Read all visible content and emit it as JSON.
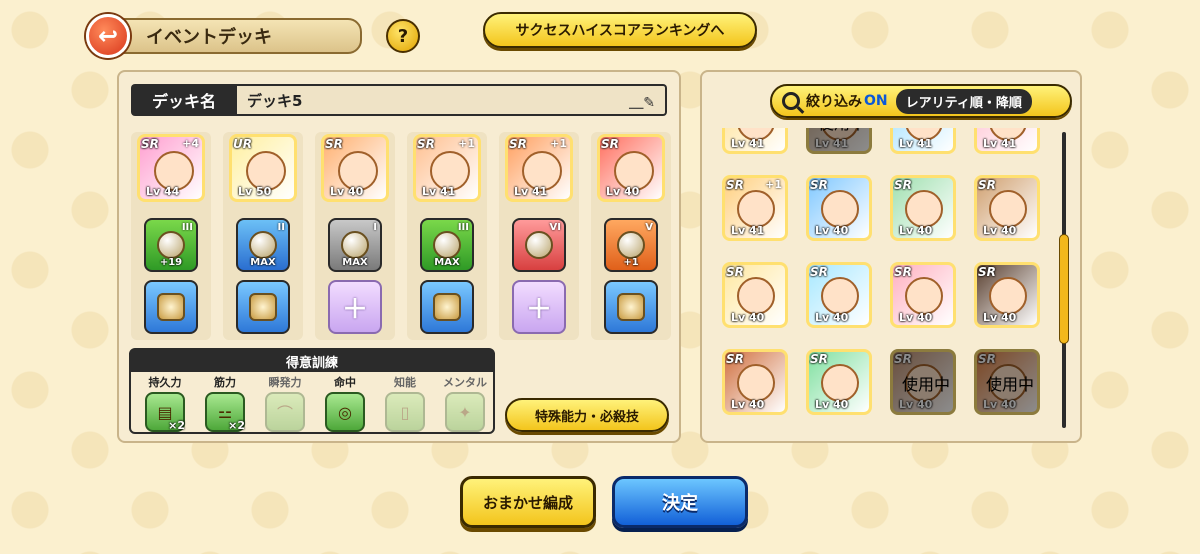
{
  "header": {
    "title": "イベントデッキ",
    "back_icon": "back-arrow-icon",
    "help_label": "?",
    "ranking_button": "サクセスハイスコアランキングへ"
  },
  "deck": {
    "name_label": "デッキ名",
    "name_value": "デッキ5",
    "slots": [
      {
        "rarity": "SR",
        "plus": "+4",
        "lv": "Lv 44",
        "color": "#ff9fd0",
        "equip": {
          "style": "green",
          "roman": "III",
          "tag": "+19"
        },
        "frame": "frame"
      },
      {
        "rarity": "UR",
        "plus": "",
        "lv": "Lv 50",
        "color": "#fff0a0",
        "equip": {
          "style": "blue",
          "roman": "II",
          "tag": "MAX"
        },
        "frame": "frame"
      },
      {
        "rarity": "SR",
        "plus": "",
        "lv": "Lv 40",
        "color": "#ffb070",
        "equip": {
          "style": "gray",
          "roman": "I",
          "tag": "MAX"
        },
        "frame": "empty"
      },
      {
        "rarity": "SR",
        "plus": "+1",
        "lv": "Lv 41",
        "color": "#ffc090",
        "equip": {
          "style": "green",
          "roman": "III",
          "tag": "MAX"
        },
        "frame": "frame"
      },
      {
        "rarity": "SR",
        "plus": "+1",
        "lv": "Lv 41",
        "color": "#ffa060",
        "equip": {
          "style": "red",
          "roman": "VI",
          "tag": ""
        },
        "frame": "empty"
      },
      {
        "rarity": "SR",
        "plus": "",
        "lv": "Lv 40",
        "color": "#ff7060",
        "equip": {
          "style": "orange",
          "roman": "V",
          "tag": "+1"
        },
        "frame": "frame"
      }
    ]
  },
  "training": {
    "title": "得意訓練",
    "items": [
      {
        "label": "持久力",
        "mult": "×2",
        "active": true,
        "icon": "barrel-icon"
      },
      {
        "label": "筋力",
        "mult": "×2",
        "active": true,
        "icon": "dumbbell-icon"
      },
      {
        "label": "瞬発力",
        "mult": "",
        "active": false,
        "icon": "shoe-icon"
      },
      {
        "label": "命中",
        "mult": "",
        "active": true,
        "icon": "target-icon"
      },
      {
        "label": "知能",
        "mult": "",
        "active": false,
        "icon": "book-icon"
      },
      {
        "label": "メンタル",
        "mult": "",
        "active": false,
        "icon": "meditation-icon"
      }
    ]
  },
  "special_button": "特殊能力・必殺技",
  "filter": {
    "label": "絞り込み",
    "state": "ON",
    "sort": "レアリティ順・降順"
  },
  "collection": [
    {
      "rarity": "",
      "plus": "",
      "lv": "Lv 41",
      "used": false,
      "color": "#ffe090"
    },
    {
      "rarity": "",
      "plus": "",
      "lv": "Lv 41",
      "used": true,
      "used_label": "使用中",
      "color": "#c0a080"
    },
    {
      "rarity": "",
      "plus": "",
      "lv": "Lv 41",
      "used": false,
      "color": "#9fe0ff"
    },
    {
      "rarity": "",
      "plus": "",
      "lv": "Lv 41",
      "used": false,
      "color": "#ffc0d0"
    },
    {
      "rarity": "SR",
      "plus": "+1",
      "lv": "Lv 41",
      "used": false,
      "color": "#ffd080"
    },
    {
      "rarity": "SR",
      "plus": "",
      "lv": "Lv 40",
      "used": false,
      "color": "#80c8ff"
    },
    {
      "rarity": "SR",
      "plus": "",
      "lv": "Lv 40",
      "used": false,
      "color": "#a0e0b0"
    },
    {
      "rarity": "SR",
      "plus": "",
      "lv": "Lv 40",
      "used": false,
      "color": "#d0a070"
    },
    {
      "rarity": "SR",
      "plus": "",
      "lv": "Lv 40",
      "used": false,
      "color": "#ffe8a0"
    },
    {
      "rarity": "SR",
      "plus": "",
      "lv": "Lv 40",
      "used": false,
      "color": "#a8e8ff"
    },
    {
      "rarity": "SR",
      "plus": "",
      "lv": "Lv 40",
      "used": false,
      "color": "#ffb0c0"
    },
    {
      "rarity": "SR",
      "plus": "",
      "lv": "Lv 40",
      "used": false,
      "color": "#5a4030"
    },
    {
      "rarity": "SR",
      "plus": "",
      "lv": "Lv 40",
      "used": false,
      "color": "#d07040"
    },
    {
      "rarity": "SR",
      "plus": "",
      "lv": "Lv 40",
      "used": false,
      "color": "#80e0a0"
    },
    {
      "rarity": "SR",
      "plus": "",
      "lv": "Lv 40",
      "used": true,
      "used_label": "使用中",
      "color": "#c09070"
    },
    {
      "rarity": "SR",
      "plus": "",
      "lv": "Lv 40",
      "used": true,
      "used_label": "使用中",
      "color": "#e08040"
    }
  ],
  "bottom": {
    "auto_button": "おまかせ編成",
    "confirm_button": "決定"
  }
}
